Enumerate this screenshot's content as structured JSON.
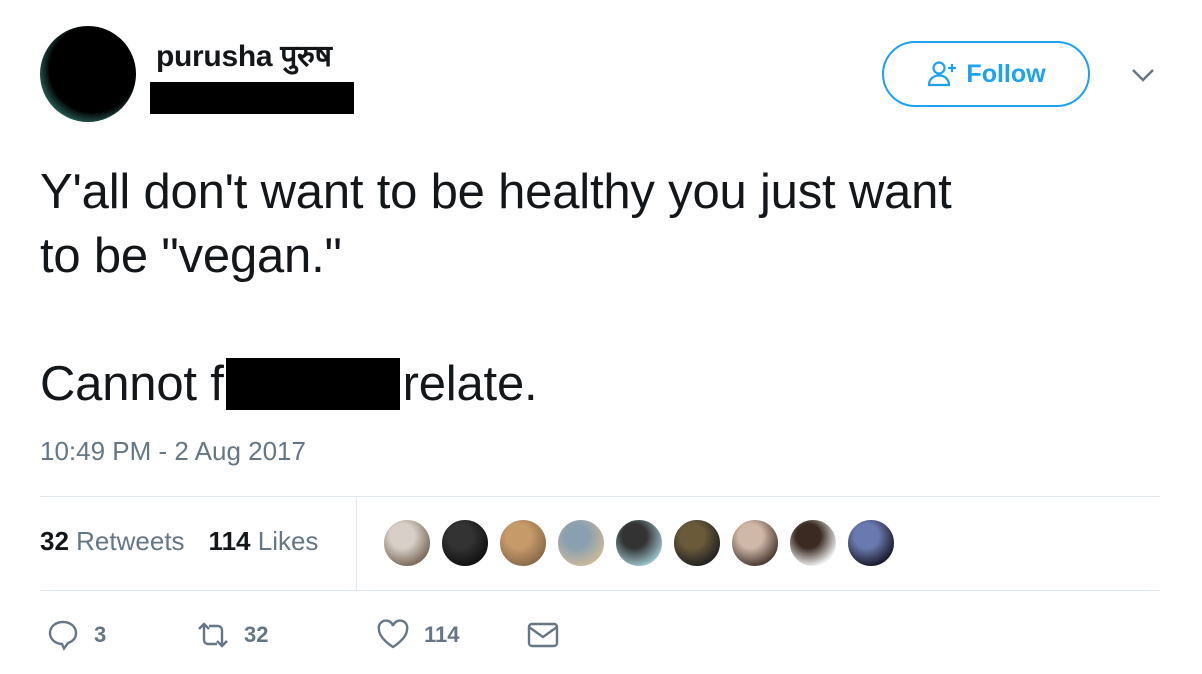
{
  "user": {
    "display_name": "purusha पुरुष",
    "handle": "[redacted]"
  },
  "follow_button": {
    "label": "Follow"
  },
  "tweet": {
    "line1": "Y'all don't want to be healthy you just want",
    "line2": "to be \"vegan.\"",
    "line3_start": "Cannot f",
    "line3_end": "relate.",
    "timestamp": "10:49 PM - 2 Aug 2017"
  },
  "stats": {
    "retweets_count": "32",
    "retweets_label": "Retweets",
    "likes_count": "114",
    "likes_label": "Likes"
  },
  "actions": {
    "reply_count": "3",
    "retweet_count": "32",
    "like_count": "114"
  },
  "colors": {
    "accent": "#1da1f2",
    "secondary_text": "#657786",
    "primary_text": "#14171a",
    "divider": "#e1e8ed"
  },
  "liker_avatars": [
    {
      "colors": [
        "#7a6a5a",
        "#d8d0c8"
      ]
    },
    {
      "colors": [
        "#111111",
        "#333333"
      ]
    },
    {
      "colors": [
        "#8a6a4a",
        "#c79a6a"
      ]
    },
    {
      "colors": [
        "#c9b89a",
        "#8aa0b0"
      ]
    },
    {
      "colors": [
        "#9ac0c8",
        "#333333"
      ]
    },
    {
      "colors": [
        "#222222",
        "#6a5a3a"
      ]
    },
    {
      "colors": [
        "#4a3a32",
        "#d0b8a8"
      ]
    },
    {
      "colors": [
        "#f2f2f2",
        "#3a2a22"
      ]
    },
    {
      "colors": [
        "#1a1a2a",
        "#6a7ab0"
      ]
    }
  ]
}
